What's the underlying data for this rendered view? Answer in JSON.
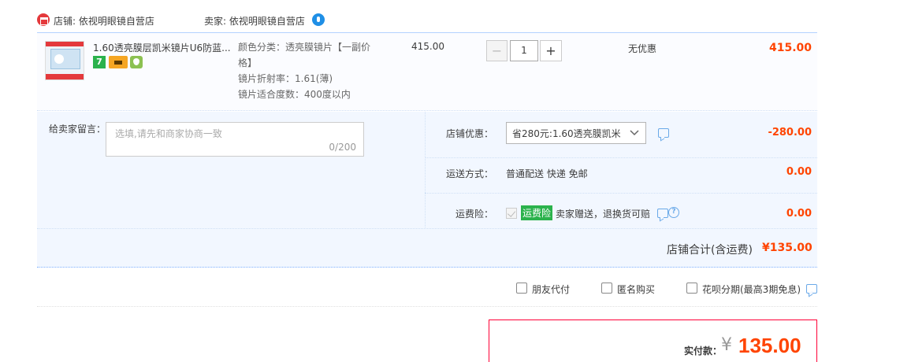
{
  "shop": {
    "shop_label": "店铺: 依视明眼镜自营店",
    "seller_label": "卖家: 依视明眼镜自营店"
  },
  "item": {
    "title": "1.60透亮膜层凯米镜片U6防蓝...",
    "props": [
      "颜色分类：透亮膜镜片【一副价",
      "格】",
      "镜片折射率：1.61(薄)",
      "镜片适合度数：400度以内"
    ],
    "badge_7": "7",
    "price": "415.00",
    "qty_minus": "−",
    "qty": "1",
    "qty_plus": "+",
    "discount": "无优惠",
    "subtotal": "415.00"
  },
  "message": {
    "label": "给卖家留言：",
    "placeholder": "选填,请先和商家协商一致",
    "count": "0/200"
  },
  "coupon": {
    "label": "店铺优惠：",
    "selected": "省280元:1.60透亮膜凯米",
    "value": "-280.00"
  },
  "shipping": {
    "label": "运送方式：",
    "text": "普通配送 快递 免邮",
    "value": "0.00"
  },
  "insurance": {
    "label": "运费险：",
    "badge": "运费险",
    "text": "卖家赠送，退换货可赔",
    "value": "0.00",
    "help": "?"
  },
  "shop_total": {
    "label": "店铺合计(含运费)",
    "value": "¥135.00"
  },
  "options": [
    "朋友代付",
    "匿名购买",
    "花呗分期(最高3期免息)"
  ],
  "pay": {
    "label": "实付款：",
    "currency": "¥",
    "amount": "135.00"
  }
}
